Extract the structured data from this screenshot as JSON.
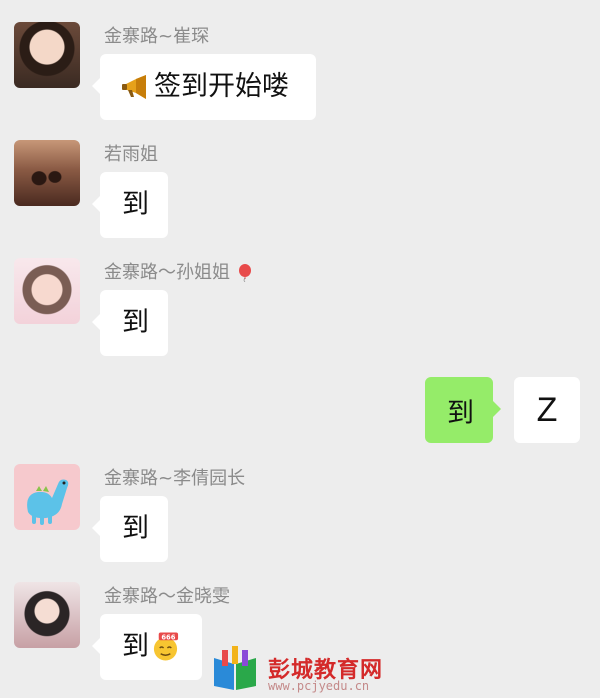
{
  "messages": [
    {
      "sender": "金寨路~崔琛",
      "text": "签到开始喽",
      "icon": "megaphone-icon"
    },
    {
      "sender": "若雨姐",
      "text": "到"
    },
    {
      "sender": "金寨路～孙姐姐",
      "text": "到",
      "sender_icon": "balloon-icon"
    },
    {
      "sender": "金寨路~李倩园长",
      "text": "到"
    },
    {
      "sender": "金寨路～金晓雯",
      "text": "到",
      "icon": "emoji-666-icon"
    }
  ],
  "own_message": {
    "text": "到",
    "avatar_letter": "Z"
  },
  "colors": {
    "background": "#ededed",
    "own_bubble": "#95ec69",
    "other_bubble": "#ffffff",
    "sender_name": "#8b8b8b"
  },
  "watermark": {
    "title": "彭城教育网",
    "url": "www.pcjyedu.cn"
  }
}
